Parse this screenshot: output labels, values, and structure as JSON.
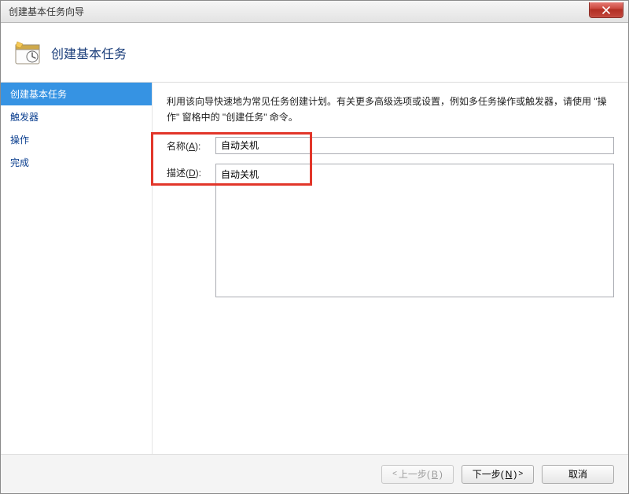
{
  "window": {
    "title": "创建基本任务向导"
  },
  "header": {
    "title": "创建基本任务"
  },
  "sidebar": {
    "items": [
      {
        "label": "创建基本任务",
        "selected": true
      },
      {
        "label": "触发器",
        "selected": false
      },
      {
        "label": "操作",
        "selected": false
      },
      {
        "label": "完成",
        "selected": false
      }
    ]
  },
  "main": {
    "instructions": "利用该向导快速地为常见任务创建计划。有关更多高级选项或设置，例如多任务操作或触发器，请使用 \"操作\" 窗格中的 \"创建任务\" 命令。",
    "name_label_pre": "名称(",
    "name_label_key": "A",
    "name_label_post": "):",
    "name_value": "自动关机",
    "desc_label_pre": "描述(",
    "desc_label_key": "D",
    "desc_label_post": "):",
    "desc_value": "自动关机"
  },
  "footer": {
    "back_pre": "上一步(",
    "back_key": "B",
    "back_post": ")",
    "next_pre": "下一步(",
    "next_key": "N",
    "next_post": ")",
    "cancel": "取消"
  }
}
